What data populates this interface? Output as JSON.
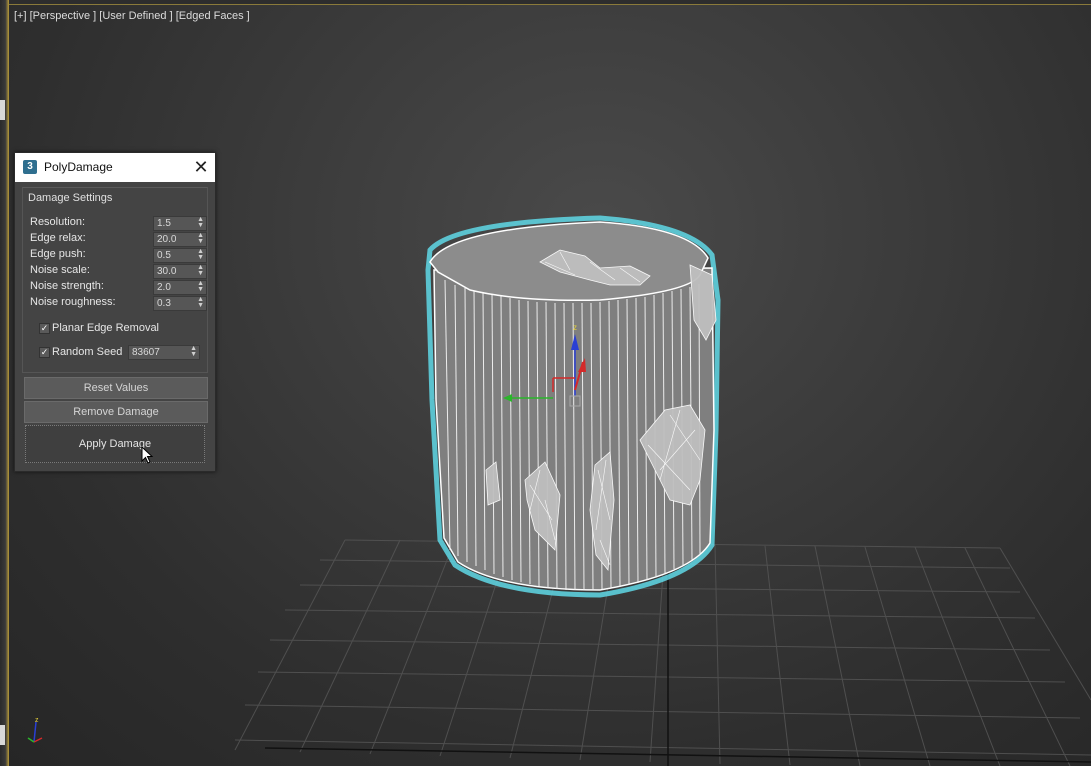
{
  "viewport": {
    "label": "[+] [Perspective ] [User Defined ] [Edged Faces ]",
    "axis_labels": {
      "z": "z"
    }
  },
  "dialog": {
    "title": "PolyDamage",
    "app_icon_text": "3",
    "close_icon": "close-icon",
    "group_title": "Damage Settings",
    "params": [
      {
        "label": "Resolution:",
        "value": "1.5"
      },
      {
        "label": "Edge relax:",
        "value": "20.0"
      },
      {
        "label": "Edge push:",
        "value": "0.5"
      },
      {
        "label": "Noise scale:",
        "value": "30.0"
      },
      {
        "label": "Noise strength:",
        "value": "2.0"
      },
      {
        "label": "Noise roughness:",
        "value": "0.3"
      }
    ],
    "planar_edge_removal": {
      "label": "Planar Edge Removal",
      "checked": true
    },
    "random_seed": {
      "label": "Random Seed",
      "checked": true,
      "value": "83607"
    },
    "buttons": {
      "reset": "Reset Values",
      "remove": "Remove Damage",
      "apply": "Apply Damage"
    }
  },
  "colors": {
    "selection_outline": "#5fd8e6",
    "wire": "#ffffff",
    "axis_x": "#d42a2a",
    "axis_y": "#2bb52b",
    "axis_z": "#2a3fd4",
    "grid": "#555555"
  }
}
